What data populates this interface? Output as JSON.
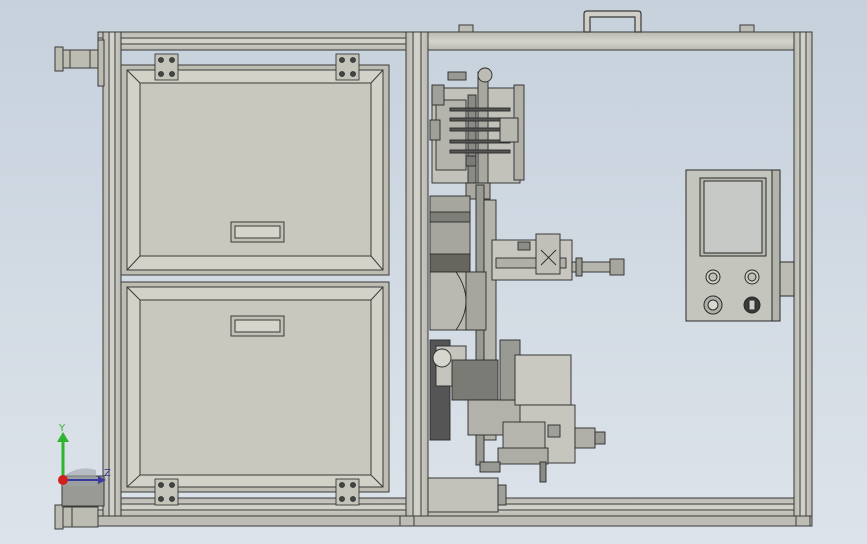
{
  "viewport": {
    "background_top": "#c6d1dc",
    "background_bottom": "#dde3ea",
    "model_colors": {
      "frame": "#c9c9c1",
      "frame_edge": "#3a3a3a",
      "panel": "#c8c7bd",
      "door": "#c9c8be",
      "dark_part": "#6b6b68",
      "control_panel": "#c4c5bd"
    }
  },
  "triad": {
    "y_label": "Y",
    "z_label": "Z",
    "y_color": "#2db52d",
    "z_color": "#3a3aa0",
    "x_color": "#d02020"
  },
  "control_panel": {
    "screen_color": "#c7c9c6",
    "button_icons": [
      "pushbutton-icon",
      "pushbutton-icon",
      "emergency-stop-icon",
      "key-switch-icon"
    ]
  }
}
